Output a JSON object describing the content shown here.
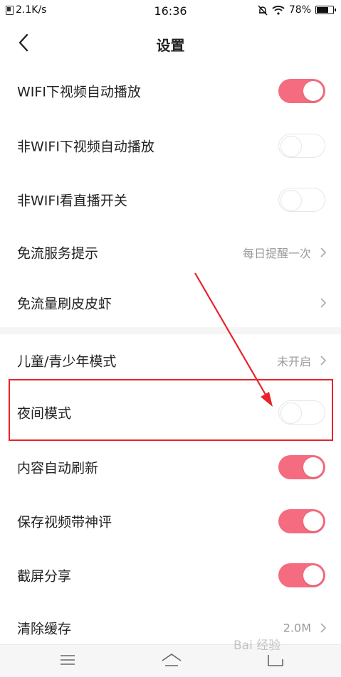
{
  "status_bar": {
    "network_speed": "2.1K/s",
    "time": "16:36",
    "battery": "78%",
    "battery_level": 0.78
  },
  "header": {
    "title": "设置"
  },
  "settings": [
    {
      "label": "WIFI下视频自动播放",
      "type": "toggle",
      "on": true
    },
    {
      "label": "非WIFI下视频自动播放",
      "type": "toggle",
      "on": false
    },
    {
      "label": "非WIFI看直播开关",
      "type": "toggle",
      "on": false
    },
    {
      "label": "免流服务提示",
      "type": "link",
      "value": "每日提醒一次"
    },
    {
      "label": "免流量刷皮皮虾",
      "type": "link",
      "value": ""
    },
    {
      "label": "儿童/青少年模式",
      "type": "link",
      "value": "未开启"
    },
    {
      "label": "夜间模式",
      "type": "toggle",
      "on": false
    },
    {
      "label": "内容自动刷新",
      "type": "toggle",
      "on": true
    },
    {
      "label": "保存视频带神评",
      "type": "toggle",
      "on": true
    },
    {
      "label": "截屏分享",
      "type": "toggle",
      "on": true
    },
    {
      "label": "清除缓存",
      "type": "link",
      "value": "2.0M"
    }
  ],
  "watermark": "Bai 经验",
  "colors": {
    "toggle_on": "#f56b80",
    "annotation": "#e8232a"
  }
}
